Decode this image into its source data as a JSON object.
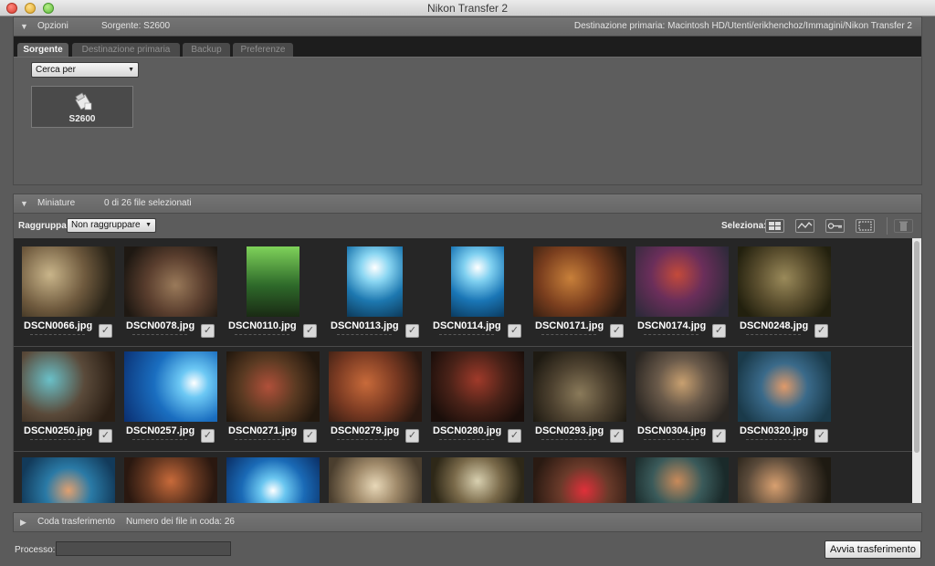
{
  "window": {
    "title": "Nikon Transfer 2"
  },
  "options": {
    "label": "Opzioni",
    "source": "Sorgente: S2600",
    "destination": "Destinazione primaria:  Macintosh HD/Utenti/erikhenchoz/Immagini/Nikon Transfer 2",
    "tabs": [
      "Sorgente",
      "Destinazione primaria",
      "Backup",
      "Preferenze"
    ],
    "search_by": "Cerca per",
    "device": "S2600"
  },
  "thumbnails": {
    "label": "Miniature",
    "selection_count": "0 di 26 file selezionati",
    "group_label": "Raggruppa:",
    "group_value": "Non raggruppare",
    "select_label": "Seleziona:",
    "rows": [
      [
        "DSCN0066.jpg",
        "DSCN0078.jpg",
        "DSCN0110.jpg",
        "DSCN0113.jpg",
        "DSCN0114.jpg",
        "DSCN0171.jpg",
        "DSCN0174.jpg",
        "DSCN0248.jpg"
      ],
      [
        "DSCN0250.jpg",
        "DSCN0257.jpg",
        "DSCN0271.jpg",
        "DSCN0279.jpg",
        "DSCN0280.jpg",
        "DSCN0293.jpg",
        "DSCN0304.jpg",
        "DSCN0320.jpg"
      ]
    ]
  },
  "queue": {
    "label": "Coda trasferimento",
    "count": "Numero dei file in coda: 26"
  },
  "bottom": {
    "process_label": "Processo:",
    "start_button": "Avvia trasferimento"
  }
}
